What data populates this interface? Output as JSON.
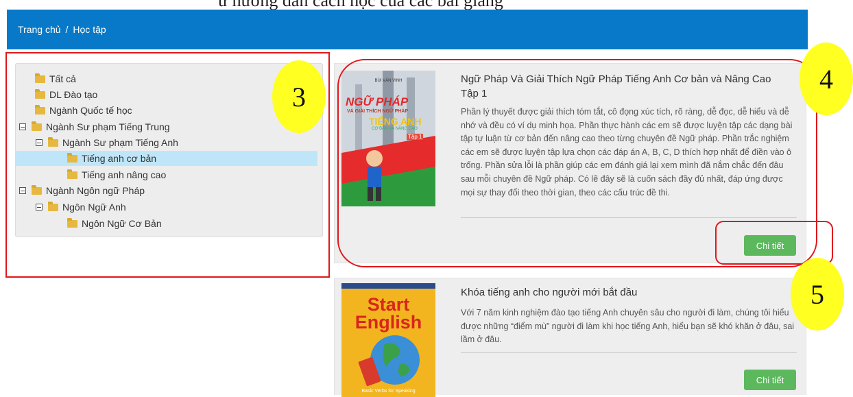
{
  "doc_fragment": "ừ hướng dẫn cách học của các bài giảng",
  "breadcrumb": {
    "home": "Trang chủ",
    "separator": "/",
    "current": "Học tập"
  },
  "tree": [
    {
      "label": "Tất cả"
    },
    {
      "label": "DL Đào tạo"
    },
    {
      "label": "Ngành Quốc tế học"
    },
    {
      "label": "Ngành Sư phạm Tiếng Trung"
    },
    {
      "label": "Ngành Sư phạm Tiếng Anh"
    },
    {
      "label": "Tiếng anh cơ bản"
    },
    {
      "label": "Tiếng anh nâng cao"
    },
    {
      "label": "Ngành Ngôn ngữ Pháp"
    },
    {
      "label": "Ngôn Ngữ Anh"
    },
    {
      "label": "Ngôn Ngữ Cơ Bản"
    }
  ],
  "courses": [
    {
      "title": "Ngữ Pháp Và Giải Thích Ngữ Pháp Tiếng Anh Cơ bản và Nâng Cao Tập 1",
      "description": "Phần lý thuyết được giải thích tóm tắt, cô đọng xúc tích, rõ ràng, dễ đọc, dễ hiểu và dễ nhớ và đều có ví dụ minh họa. Phần thực hành các em sẽ được luyện tập các dạng bài tập tự luận từ cơ bản đến nâng cao theo từng chuyên đề Ngữ pháp. Phần trắc nghiệm các em sẽ được luyện tập lựa chọn các đáp án A, B, C, D thích hợp nhất để điền vào ô trống. Phần sửa lỗi là phần giúp các em đánh giá lại xem mình đã nắm chắc đến đâu sau mỗi chuyên đề Ngữ pháp. Có lẽ đây sẽ là cuốn sách đầy đủ nhất, đáp ứng được mọi sự thay đổi theo thời gian, theo các cấu trúc đề thi.",
      "button": "Chi tiết",
      "cover": {
        "author": "BÙI VĂN VINH",
        "line1": "NGỮ PHÁP",
        "line2": "VÀ GIẢI THÍCH NGỮ PHÁP",
        "line3": "TIẾNG ANH",
        "line4": "CƠ BẢN VÀ NÂNG CAO",
        "line5": "Tập 1"
      }
    },
    {
      "title": "Khóa tiếng anh cho người mới bắt đầu",
      "description": "Với 7 năm kinh nghiệm đào tạo tiếng Anh chuyên sâu cho người đi làm, chúng tôi hiểu được những “điểm mù” người đi làm khi học tiếng Anh, hiểu bạn sẽ khó khăn ở đâu, sai lầm ở đâu.",
      "button": "Chi tiết",
      "cover": {
        "line1": "Start",
        "line2": "English",
        "footer": "Basic Verbs for Speaking"
      }
    }
  ],
  "annotations": [
    "3",
    "4",
    "5"
  ],
  "colors": {
    "header": "#0779c8",
    "button": "#5cb85c",
    "annotation_border": "#e0161b",
    "annotation_badge": "#ffff22",
    "selected": "#bfe6f8"
  }
}
